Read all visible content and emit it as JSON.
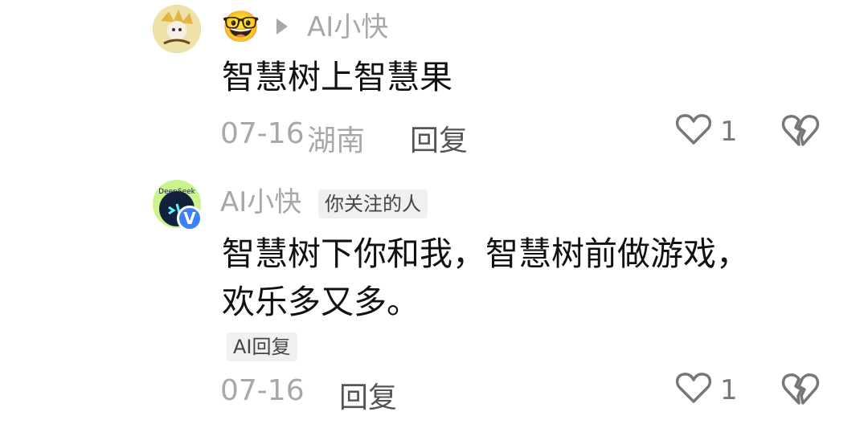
{
  "comments": [
    {
      "author_emoji": "🤓",
      "reply_to": "AI小快",
      "text": "智慧树上智慧果",
      "date": "07-16",
      "location": "湖南",
      "reply_label": "回复",
      "like_count": "1"
    },
    {
      "author": "AI小快",
      "author_tag": "你关注的人",
      "avatar_label": "DeepSeek",
      "verified_label": "V",
      "text_line1": "智慧树下你和我，智慧树前做游戏，",
      "text_line2": "欢乐多又多。",
      "ai_reply_tag": "AI回复",
      "date": "07-16",
      "reply_label": "回复",
      "like_count": "1"
    }
  ]
}
